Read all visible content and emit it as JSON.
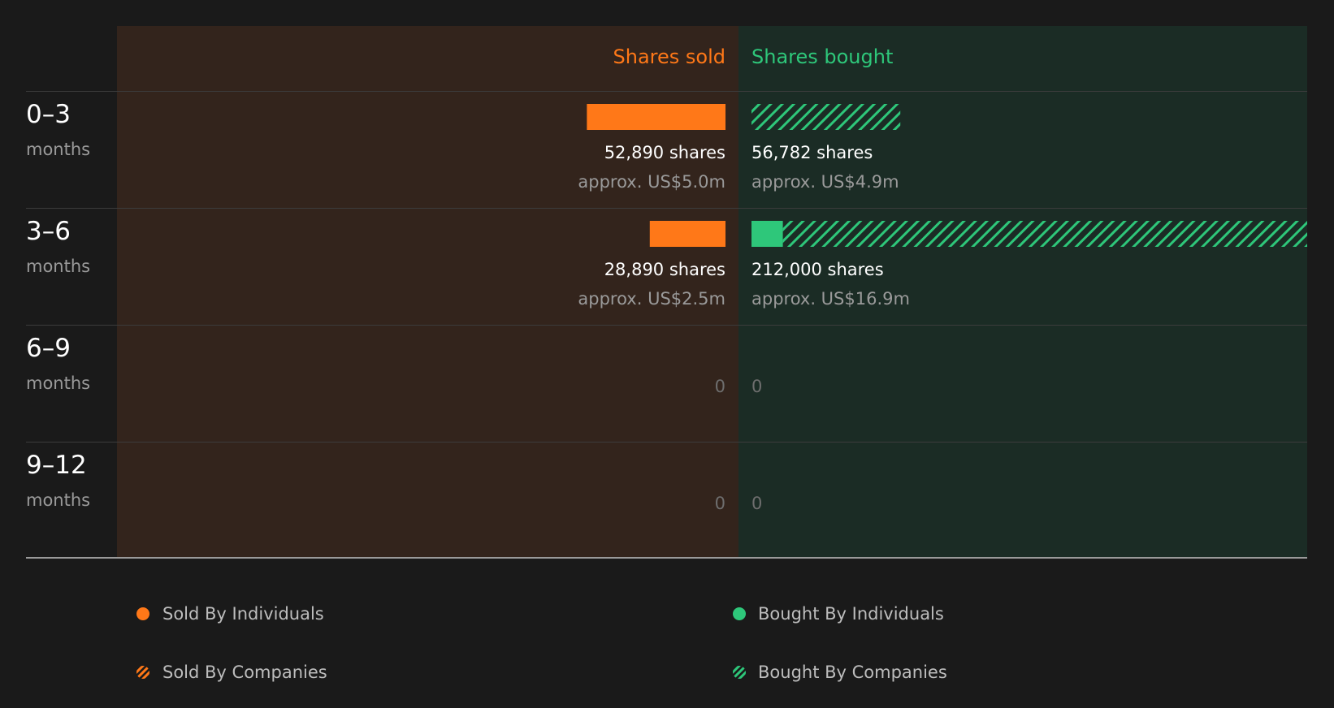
{
  "colors": {
    "sold": "#ff7818",
    "bought": "#2ec77a",
    "background": "#1a1a1a",
    "sold_panel": "#33241c",
    "bought_panel": "#1b2c25"
  },
  "chart_data": {
    "type": "bar",
    "orientation": "horizontal-diverging",
    "column_titles": {
      "sold": "Shares sold",
      "bought": "Shares bought"
    },
    "categories": [
      {
        "range": "0–3",
        "unit": "months"
      },
      {
        "range": "3–6",
        "unit": "months"
      },
      {
        "range": "6–9",
        "unit": "months"
      },
      {
        "range": "9–12",
        "unit": "months"
      }
    ],
    "series": [
      {
        "name": "Sold By Individuals",
        "side": "sold",
        "pattern": "solid",
        "values": [
          52890,
          28890,
          0,
          0
        ]
      },
      {
        "name": "Sold By Companies",
        "side": "sold",
        "pattern": "hatched",
        "values": [
          0,
          0,
          0,
          0
        ]
      },
      {
        "name": "Bought By Individuals",
        "side": "bought",
        "pattern": "solid",
        "values": [
          0,
          12000,
          0,
          0
        ]
      },
      {
        "name": "Bought By Companies",
        "side": "bought",
        "pattern": "hatched",
        "values": [
          56782,
          200000,
          0,
          0
        ]
      }
    ],
    "sold_labels": [
      {
        "shares": "52,890 shares",
        "value": "approx. US$5.0m"
      },
      {
        "shares": "28,890 shares",
        "value": "approx. US$2.5m"
      },
      {
        "shares": "0",
        "value": ""
      },
      {
        "shares": "0",
        "value": ""
      }
    ],
    "bought_labels": [
      {
        "shares": "56,782 shares",
        "value": "approx. US$4.9m"
      },
      {
        "shares": "212,000 shares",
        "value": "approx. US$16.9m"
      },
      {
        "shares": "0",
        "value": ""
      },
      {
        "shares": "0",
        "value": ""
      }
    ],
    "legend": [
      {
        "label": "Sold By Individuals",
        "side": "sold",
        "pattern": "solid"
      },
      {
        "label": "Bought By Individuals",
        "side": "bought",
        "pattern": "solid"
      },
      {
        "label": "Sold By Companies",
        "side": "sold",
        "pattern": "hatched"
      },
      {
        "label": "Bought By Companies",
        "side": "bought",
        "pattern": "hatched"
      }
    ],
    "legend_placement": "bottom"
  }
}
